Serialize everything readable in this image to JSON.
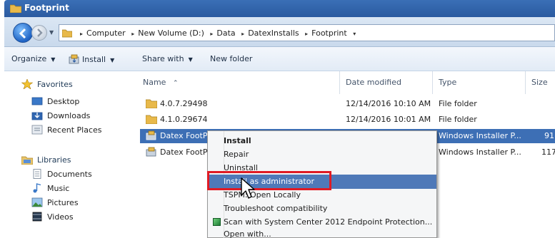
{
  "window": {
    "title": "Footprint"
  },
  "address_bar": {
    "breadcrumbs": [
      "Computer",
      "New Volume (D:)",
      "Data",
      "DatexInstalls",
      "Footprint"
    ]
  },
  "toolbar": {
    "organize": "Organize",
    "install": "Install",
    "share_with": "Share with",
    "new_folder": "New folder"
  },
  "navigation": {
    "favorites": {
      "label": "Favorites",
      "items": [
        "Desktop",
        "Downloads",
        "Recent Places"
      ]
    },
    "libraries": {
      "label": "Libraries",
      "items": [
        "Documents",
        "Music",
        "Pictures",
        "Videos"
      ]
    }
  },
  "columns": {
    "name": "Name",
    "date_modified": "Date modified",
    "type": "Type",
    "size": "Size"
  },
  "files": [
    {
      "name": "4.0.7.29498",
      "date": "12/14/2016 10:10 AM",
      "type": "File folder",
      "size": "",
      "icon": "folder-icon"
    },
    {
      "name": "4.1.0.29674",
      "date": "12/14/2016 10:01 AM",
      "type": "File folder",
      "size": "",
      "icon": "folder-icon"
    },
    {
      "name": "Datex FootP",
      "date": "",
      "type": "Windows Installer P...",
      "size": "91",
      "icon": "installer-icon"
    },
    {
      "name": "Datex FootP",
      "date": "",
      "type": "Windows Installer P...",
      "size": "117",
      "icon": "installer-icon"
    }
  ],
  "context_menu": {
    "items": [
      "Install",
      "Repair",
      "Uninstall",
      "Install as administrator",
      "TSPM: Open Locally",
      "Troubleshoot compatibility",
      "Scan with System Center 2012 Endpoint Protection...",
      "Open with..."
    ],
    "highlighted": "Install as administrator"
  },
  "colors": {
    "title_bar": "#2a5aa0",
    "selection": "#3d6fb5",
    "menu_highlight": "#4f79b8",
    "annotation_box": "#e01b24"
  }
}
